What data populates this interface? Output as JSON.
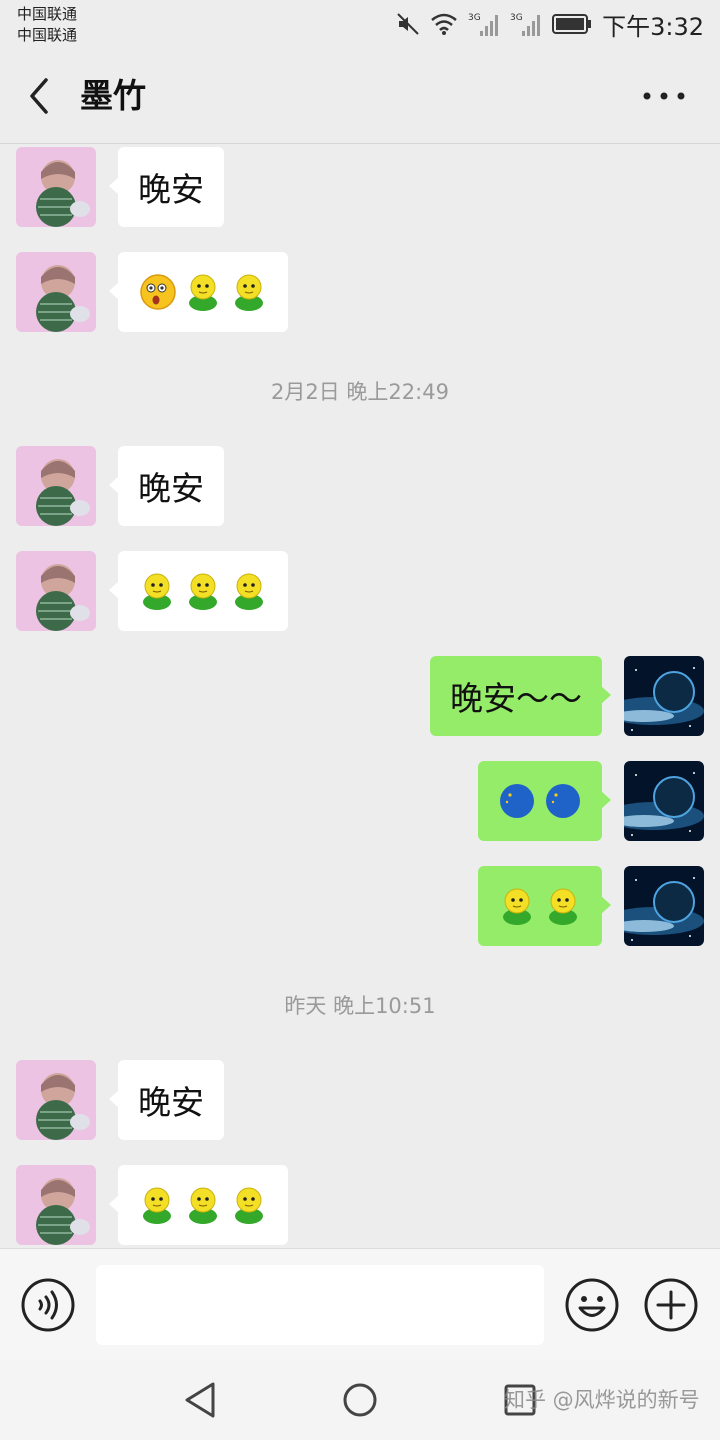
{
  "status_bar": {
    "carrier_1": "中国联通",
    "carrier_2": "中国联通",
    "network_1": "3G",
    "network_2": "3G",
    "time": "下午3:32"
  },
  "header": {
    "back_icon": "chevron-left-icon",
    "title": "墨竹",
    "more_icon": "more-dots-icon"
  },
  "messages": [
    {
      "side": "in",
      "text": "晚安"
    },
    {
      "side": "in",
      "emojis": [
        "surprised-emoji",
        "green-man-emoji",
        "green-man-emoji"
      ]
    },
    {
      "timestamp": "2月2日 晚上22:49"
    },
    {
      "side": "in",
      "text": "晚安"
    },
    {
      "side": "in",
      "emojis": [
        "green-man-emoji",
        "green-man-emoji",
        "green-man-emoji"
      ]
    },
    {
      "side": "out",
      "text": "晚安～～"
    },
    {
      "side": "out",
      "emojis": [
        "moon-emoji",
        "moon-emoji"
      ]
    },
    {
      "side": "out",
      "emojis": [
        "green-man-emoji",
        "green-man-emoji"
      ]
    },
    {
      "timestamp": "昨天 晚上10:51"
    },
    {
      "side": "in",
      "text": "晚安"
    },
    {
      "side": "in",
      "emojis": [
        "green-man-emoji",
        "green-man-emoji",
        "green-man-emoji"
      ]
    }
  ],
  "input_bar": {
    "voice_icon": "voice-icon",
    "input_value": "",
    "emoji_icon": "smiley-icon",
    "plus_icon": "plus-icon"
  },
  "nav_bar": {
    "back_icon": "nav-back-icon",
    "home_icon": "nav-home-icon",
    "recent_icon": "nav-recent-icon",
    "watermark": "知乎 @风烨说的新号"
  },
  "colors": {
    "background": "#ededed",
    "incoming_bubble": "#ffffff",
    "outgoing_bubble": "#95ec69",
    "timestamp_text": "#9a9a9a"
  }
}
